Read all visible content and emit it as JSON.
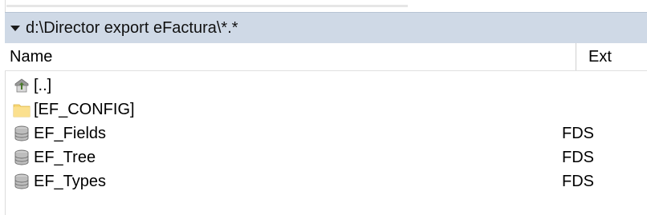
{
  "header": {
    "path": "d:\\Director export eFactura\\*.*"
  },
  "columns": {
    "name": "Name",
    "ext": "Ext"
  },
  "files": [
    {
      "icon": "parent-folder-icon",
      "name": "[..]",
      "ext": ""
    },
    {
      "icon": "folder-icon",
      "name": "[EF_CONFIG]",
      "ext": ""
    },
    {
      "icon": "database-icon",
      "name": "EF_Fields",
      "ext": "FDS"
    },
    {
      "icon": "database-icon",
      "name": "EF_Tree",
      "ext": "FDS"
    },
    {
      "icon": "database-icon",
      "name": "EF_Types",
      "ext": "FDS"
    }
  ],
  "colors": {
    "header_bg": "#cfd9e6",
    "folder_yellow": "#f8d775"
  }
}
